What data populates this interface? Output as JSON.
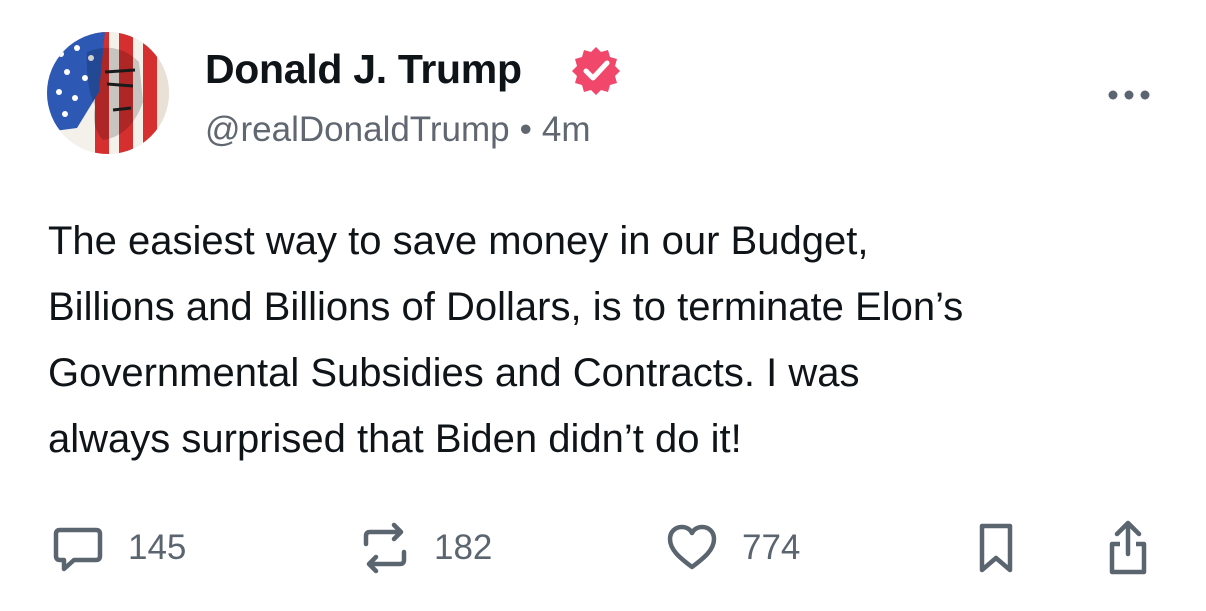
{
  "author": {
    "display_name": "Donald J. Trump",
    "handle": "@realDonaldTrump",
    "separator": "•",
    "time": "4m",
    "verified_color": "#f0476b"
  },
  "post": {
    "lines": [
      "The easiest way to save money in our Budget,",
      "Billions and Billions of Dollars, is to terminate Elon’s",
      "Governmental Subsidies and Contracts. I was",
      "always surprised that Biden didn’t do it!"
    ]
  },
  "actions": {
    "replies": "145",
    "reposts": "182",
    "likes": "774"
  },
  "icons": {
    "more": "more-horizontal-icon",
    "reply": "comment-bubble-icon",
    "repost": "repost-arrows-icon",
    "like": "heart-icon",
    "bookmark": "bookmark-icon",
    "share": "share-upload-icon"
  },
  "colors": {
    "text": "#0f1419",
    "secondary": "#606770",
    "icon": "#5b6570"
  }
}
